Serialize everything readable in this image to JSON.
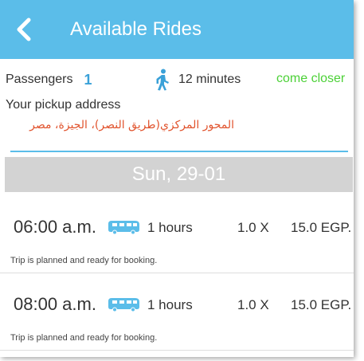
{
  "header": {
    "title": "Available Rides"
  },
  "info": {
    "passengers_label": "Passengers",
    "passengers_count": "1",
    "walk_time": "12 minutes",
    "come_closer": "come closer",
    "pickup_label": "Your pickup address",
    "pickup_address": "المحور المركزي(طريق النصر)، الجيزة، مصر"
  },
  "date_header": "Sun, 29-01",
  "trips": [
    {
      "time": "06:00 a.m.",
      "duration": "1 hours",
      "multiplier": "1.0 X",
      "price": "15.0 EGP.",
      "status": "Trip is planned and ready for booking."
    },
    {
      "time": "08:00 a.m.",
      "duration": "1 hours",
      "multiplier": "1.0 X",
      "price": "15.0 EGP.",
      "status": "Trip is planned and ready for booking."
    }
  ],
  "colors": {
    "appbar": "#5bbde9",
    "passenger_count": "#3aa1d8",
    "come_closer": "#4cd137",
    "address": "#e1532d",
    "date_band": "#d3d3d3"
  },
  "icons": {
    "back": "chevron-left-icon",
    "walk": "walking-person-icon",
    "bus": "bus-icon"
  }
}
